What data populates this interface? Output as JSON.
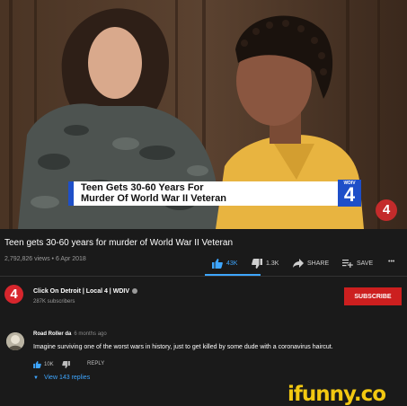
{
  "video": {
    "lower_third_line1": "Teen Gets 30-60 Years For",
    "lower_third_line2": "Murder Of World War II Veteran",
    "station_label": "WDIV",
    "station_number": "4",
    "corner_logo": "4"
  },
  "info": {
    "title": "Teen gets 30-60 years for murder of World War II Veteran",
    "views": "2,792,826 views",
    "date": "6 Apr 2018",
    "meta_separator": "•"
  },
  "actions": {
    "likes": "43K",
    "dislikes": "1.3K",
    "share_label": "SHARE",
    "save_label": "SAVE",
    "more_label": "•••"
  },
  "channel": {
    "logo_text": "4",
    "name": "Click On Detroit | Local 4 | WDIV",
    "subscribers": "287K subscribers",
    "subscribe_label": "SUBSCRIBE"
  },
  "comment": {
    "author": "Road Roller da",
    "time": "6 months ago",
    "text": "Imagine surviving one of the worst wars in history, just to get killed by some dude with a coronavirus haircut.",
    "likes": "10K",
    "reply_label": "REPLY",
    "view_replies": "View 143 replies",
    "view_replies_chevron": "▼"
  },
  "watermark": {
    "text": "ifunny.co"
  },
  "colors": {
    "accent_blue": "#3ea6ff",
    "subscribe_red": "#cc1f1f",
    "wdiv_blue": "#1e4fc8",
    "watermark_yellow": "#f2c811"
  }
}
